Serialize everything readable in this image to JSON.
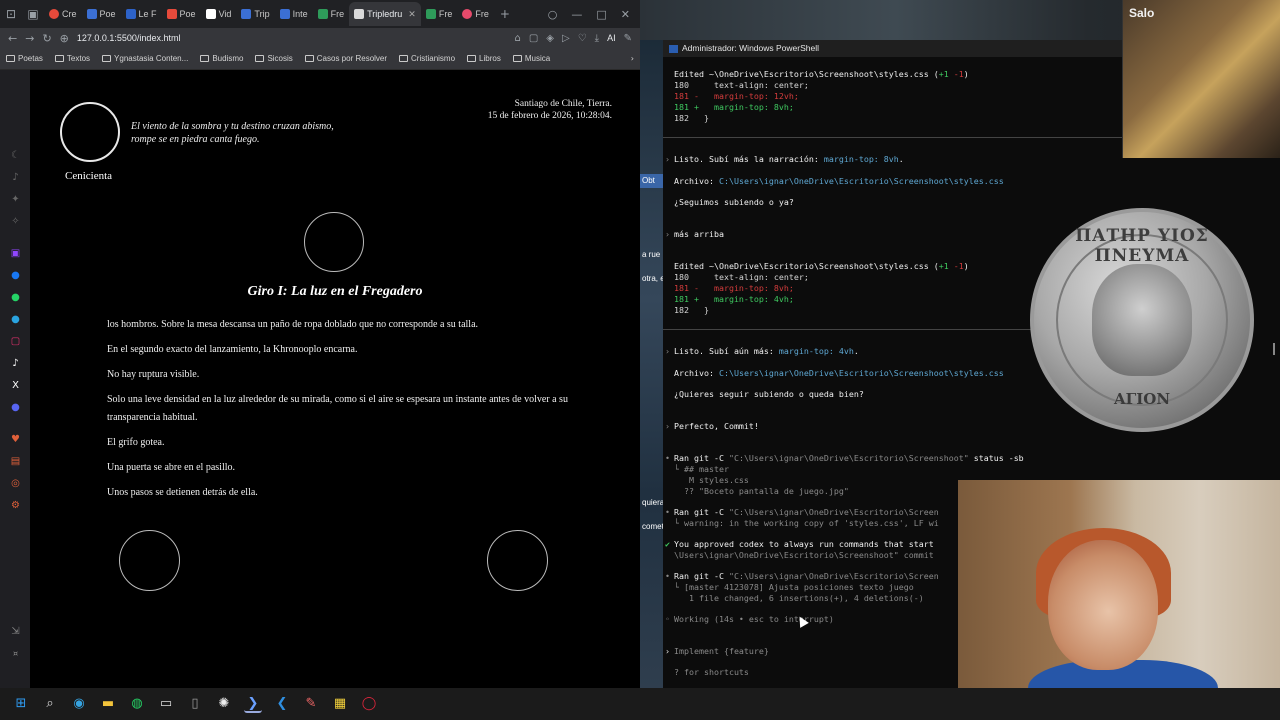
{
  "browser": {
    "tabs": [
      {
        "label": "Cre",
        "color": "#e64a3b"
      },
      {
        "label": "Poe",
        "color": "#3b6fd4"
      },
      {
        "label": "Le F",
        "color": "#2d62c8"
      },
      {
        "label": "Poe",
        "color": "#e64a3b"
      },
      {
        "label": "Vid",
        "color": "#ffffff"
      },
      {
        "label": "Trip",
        "color": "#3b6fd4"
      },
      {
        "label": "Inte",
        "color": "#3b6fd4"
      },
      {
        "label": "Fre",
        "color": "#2e9b5a"
      },
      {
        "label": "Tripledru",
        "color": "#d9d9d9",
        "active": true
      },
      {
        "label": "Fre",
        "color": "#2e9b5a"
      },
      {
        "label": "Fre",
        "color": "#e64a6b"
      }
    ],
    "url": "127.0.0.1:5500/index.html",
    "ai_label": "AI",
    "bookmarks": [
      "Poetas",
      "Textos",
      "Ygnastasia Conten...",
      "Budismo",
      "Sicosis",
      "Casos por Resolver",
      "Cristianismo",
      "Libros",
      "Musica"
    ]
  },
  "page": {
    "character_name": "Cenicienta",
    "quote_line1": "El viento de la sombra y tu destino cruzan abismo,",
    "quote_line2": "rompe se en piedra canta fuego.",
    "location": "Santiago de Chile, Tierra.",
    "datetime": "15 de febrero de 2026, 10:28:04.",
    "chapter_title": "Giro I: La luz en el Fregadero",
    "narration": [
      "los hombros. Sobre la mesa descansa un paño de ropa doblado que no corresponde a su talla.",
      "En el segundo exacto del lanzamiento, la Khronooplo encarna.",
      "No hay ruptura visible.",
      "Solo una leve densidad en la luz alrededor de su mirada, como si el aire se espesara un instante antes de volver a su transparencia habitual.",
      "El grifo gotea.",
      "Una puerta se abre en el pasillo.",
      "Unos pasos se detienen detrás de ella."
    ]
  },
  "side_labels": [
    "Obt",
    "a rue",
    "otra, e",
    "quiera",
    "comet"
  ],
  "powershell": {
    "title": "Administrador: Windows PowerShell",
    "edit1_header": "Edited ~\\OneDrive\\Escritorio\\Screenshoot\\styles.css",
    "edit1_stats_add": "+1",
    "edit1_stats_del": "-1",
    "edit1_lines": [
      "180     text-align: center;",
      "181 -   margin-top: 12vh;",
      "181 +   margin-top: 8vh;",
      "182   }"
    ],
    "msg1": "Listo. Subí más la narración: ",
    "msg1_code": "margin-top: 8vh",
    "file_label": "Archivo: ",
    "file_path": "C:\\Users\\ignar\\OneDrive\\Escritorio\\Screenshoot\\styles.css",
    "q1": "¿Seguimos subiendo o ya?",
    "user1": "más arriba",
    "edit2_header": "Edited ~\\OneDrive\\Escritorio\\Screenshoot\\styles.css",
    "edit2_lines": [
      "180     text-align: center;",
      "181 -   margin-top: 8vh;",
      "181 +   margin-top: 4vh;",
      "182   }"
    ],
    "msg2": "Listo. Subí aún más: ",
    "msg2_code": "margin-top: 4vh",
    "q2": "¿Quieres seguir subiendo o queda bien?",
    "user2": "Perfecto, Commit!",
    "git1_cmd": "Ran git -C ",
    "git1_path": "\"C:\\Users\\ignar\\OneDrive\\Escritorio\\Screenshoot\"",
    "git1_args": " status -sb",
    "git1_out": [
      "└ ## master",
      "   M styles.css",
      "  ?? \"Boceto pantalla de juego.jpg\""
    ],
    "git2_path": "\"C:\\Users\\ignar\\OneDrive\\Escritorio\\Screen",
    "git2_out": "└ warning: in the working copy of 'styles.css', LF wi",
    "approved": "You approved codex to always run commands that start",
    "approved_path": "\\Users\\ignar\\OneDrive\\Escritorio\\Screenshoot\" commit",
    "git3_path": "\"C:\\Users\\ignar\\OneDrive\\Escritorio\\Screen",
    "git3_out1": "└ [master 4123078] Ajusta posiciones texto juego",
    "git3_out2": "   1 file changed, 6 insertions(+), 4 deletions(-)",
    "working": "Working (14s • esc to interrupt)",
    "implement": "Implement {feature}",
    "shortcuts": "? for shortcuts"
  },
  "overlay": {
    "thumb_label": "Salo",
    "coin_top": "ΠΑΤΗΡ ΥΙΟΣ ΠΝΕΥΜΑ",
    "coin_bottom": "ΑΓΙΟΝ"
  },
  "taskbar": [
    "windows-start",
    "search",
    "edge",
    "file-explorer",
    "whatsapp",
    "app",
    "app",
    "chatgpt",
    "powershell",
    "vscode",
    "paint",
    "notes",
    "opera"
  ]
}
